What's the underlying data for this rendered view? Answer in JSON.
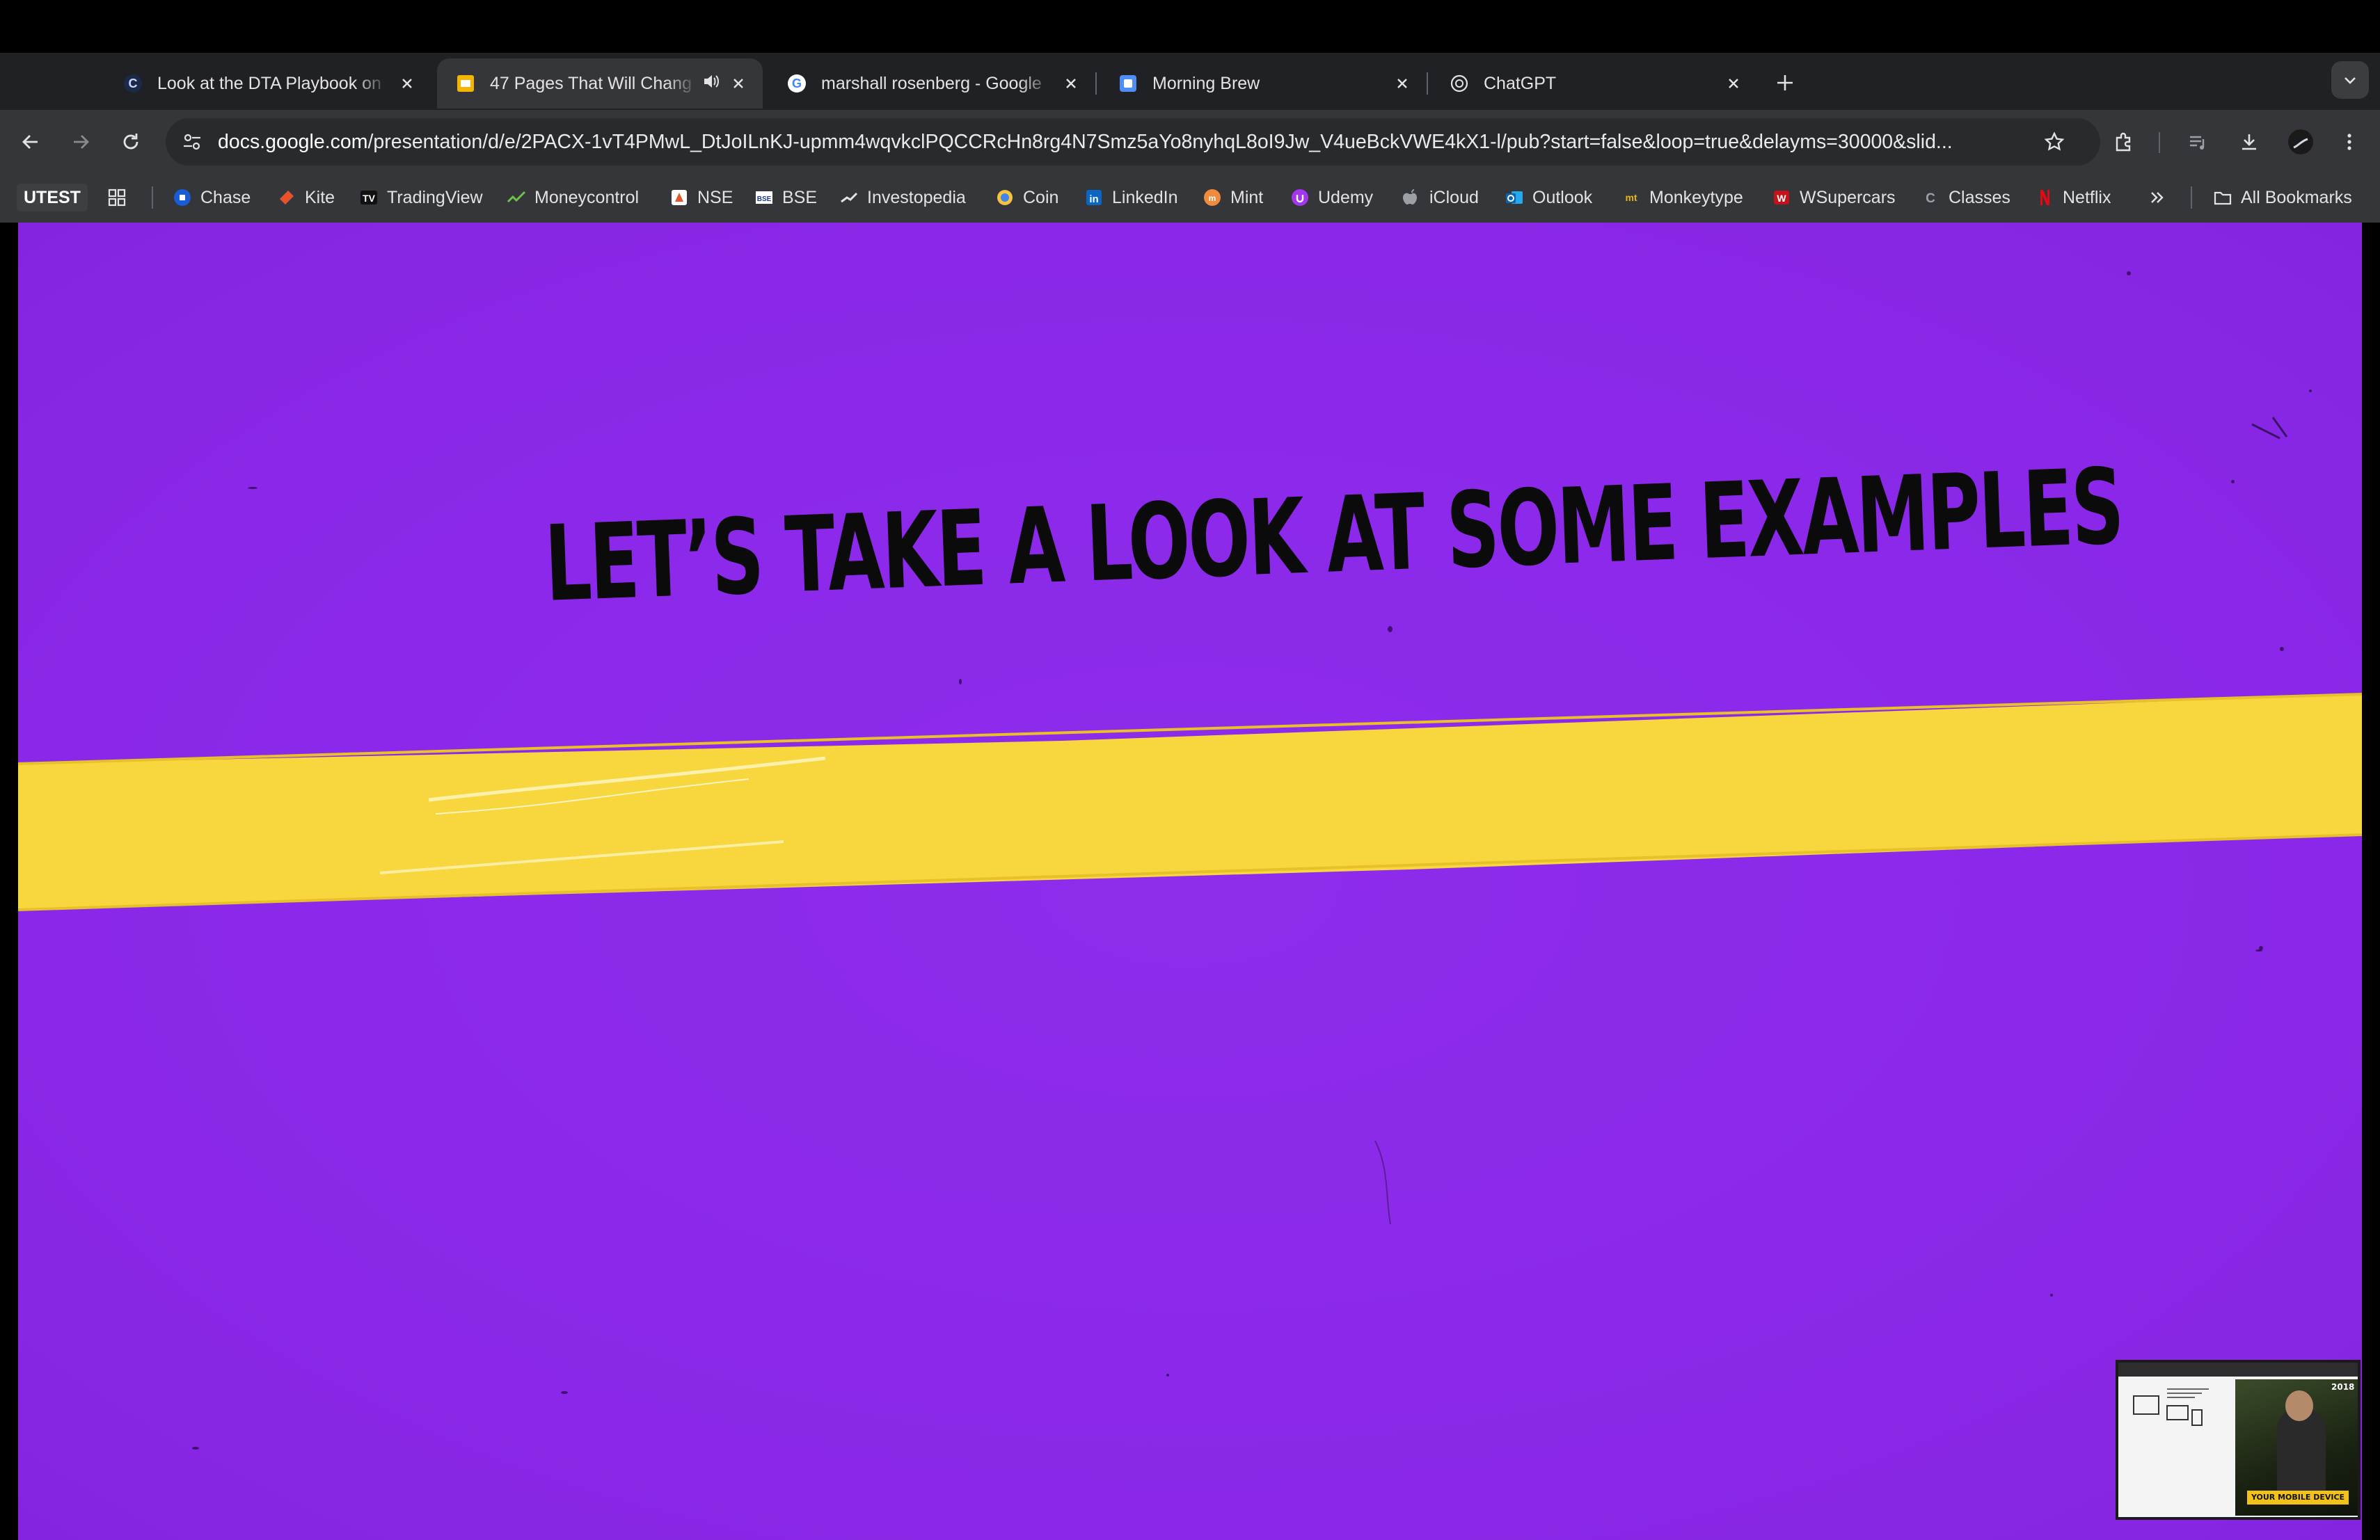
{
  "tabs": [
    {
      "title": "Look at the DTA Playbook on ",
      "favicon": "c-logo-icon"
    },
    {
      "title": "47 Pages That Will Chang",
      "favicon": "google-slides-icon",
      "active": true,
      "audio": true
    },
    {
      "title": "marshall rosenberg - Google ",
      "favicon": "google-g-icon"
    },
    {
      "title": "Morning Brew",
      "favicon": "morning-brew-icon"
    },
    {
      "title": "ChatGPT",
      "favicon": "chatgpt-icon"
    }
  ],
  "address_bar": {
    "host": "docs.google.com",
    "path": "/presentation/d/e/2PACX-1vT4PMwL_DtJoILnKJ-upmm4wqvkclPQCCRcHn8rg4N7Smz5aYo8nyhqL8oI9Jw_V4ueBckVWE4kX1-l/pub?start=false&loop=true&delayms=30000&slid..."
  },
  "bookmarks": {
    "utest": "UTEST",
    "items": [
      {
        "label": "Chase",
        "icon": "chase-icon"
      },
      {
        "label": "Kite",
        "icon": "kite-icon"
      },
      {
        "label": "TradingView",
        "icon": "tradingview-icon"
      },
      {
        "label": "Moneycontrol",
        "icon": "moneycontrol-icon"
      },
      {
        "label": "NSE",
        "icon": "nse-icon"
      },
      {
        "label": "BSE",
        "icon": "bse-icon"
      },
      {
        "label": "Investopedia",
        "icon": "investopedia-icon"
      },
      {
        "label": "Coin",
        "icon": "coin-icon"
      },
      {
        "label": "LinkedIn",
        "icon": "linkedin-icon"
      },
      {
        "label": "Mint",
        "icon": "mint-icon"
      },
      {
        "label": "Udemy",
        "icon": "udemy-icon"
      },
      {
        "label": "iCloud",
        "icon": "apple-icon"
      },
      {
        "label": "Outlook",
        "icon": "outlook-icon"
      },
      {
        "label": "Monkeytype",
        "icon": "monkeytype-icon"
      },
      {
        "label": "WSupercars",
        "icon": "wsupercars-icon"
      },
      {
        "label": "Classes",
        "icon": "classes-icon"
      },
      {
        "label": "Netflix",
        "icon": "netflix-icon"
      }
    ],
    "all_bookmarks": "All Bookmarks"
  },
  "slide": {
    "headline": "LET’S TAKE A LOOK AT SOME EXAMPLES",
    "background_color": "#8A28E8",
    "tape_color": "#F7D63E"
  },
  "pip_preview": {
    "badge": "YOUR MOBILE DEVICE",
    "year": "2018"
  }
}
